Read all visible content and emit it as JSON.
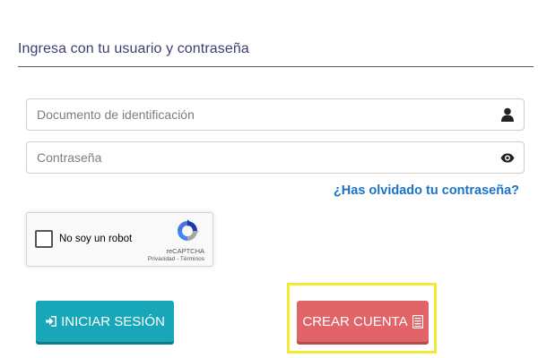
{
  "form": {
    "heading": "Ingresa con tu usuario y contraseña",
    "username": {
      "placeholder": "Documento de identificación",
      "value": "",
      "icon": "user-icon"
    },
    "password": {
      "placeholder": "Contraseña",
      "value": "",
      "icon": "eye-icon"
    },
    "forgot_link": "¿Has olvidado tu contraseña?"
  },
  "recaptcha": {
    "label": "No soy un robot",
    "brand": "reCAPTCHA",
    "links": "Privacidad - Términos"
  },
  "actions": {
    "login_label": "INICIAR SESIÓN",
    "login_icon": "sign-in-icon",
    "create_label": "CREAR CUENTA",
    "create_icon": "list-icon"
  },
  "colors": {
    "heading": "#3a3f6e",
    "link": "#1a73c8",
    "login_button": "#17a7b8",
    "create_button": "#e06468",
    "highlight": "#f2ea2e"
  }
}
